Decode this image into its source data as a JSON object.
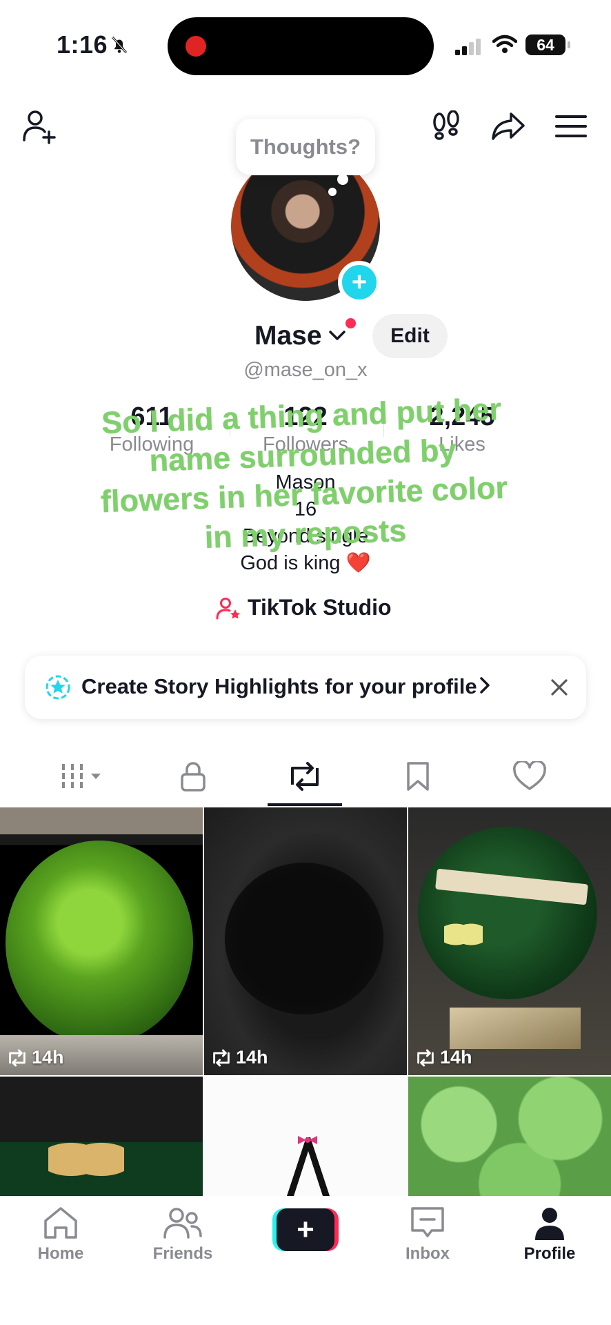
{
  "status_bar": {
    "time": "1:16",
    "battery": "64"
  },
  "profile": {
    "thought_prompt": "Thoughts?",
    "name": "Mase",
    "edit_label": "Edit",
    "handle": "@mase_on_x",
    "stats": [
      {
        "value": "611",
        "label": "Following"
      },
      {
        "value": "122",
        "label": "Followers"
      },
      {
        "value": "2,245",
        "label": "Likes"
      }
    ],
    "bio_lines": [
      "Mason",
      "16",
      "Beyond single",
      "God is king ❤️"
    ],
    "studio_label": "TikTok Studio"
  },
  "caption": {
    "text": "So I did a thing and put her name surrounded by flowers in her favorite color in my reposts"
  },
  "banner": {
    "text": "Create Story Highlights for your profile"
  },
  "tabs": [
    "videos",
    "private",
    "reposts",
    "favorites",
    "liked"
  ],
  "grid": {
    "tiles": [
      {
        "time": "14h",
        "desc": "green rose bouquet"
      },
      {
        "time": "14h",
        "desc": "dark glitter bouquet"
      },
      {
        "time": "14h",
        "desc": "happy birthday bouquet"
      },
      {
        "time": "",
        "desc": "butterfly bouquet"
      },
      {
        "time": "",
        "desc": "logo with bow"
      },
      {
        "time": "",
        "desc": "green roses close-up"
      }
    ]
  },
  "bottom_nav": {
    "home": "Home",
    "friends": "Friends",
    "inbox": "Inbox",
    "profile": "Profile"
  },
  "colors": {
    "accent_cyan": "#20d5ec",
    "accent_red": "#fe2c55",
    "caption_green": "#7ed16a",
    "text_primary": "#161823",
    "text_secondary": "#8a8b91"
  }
}
